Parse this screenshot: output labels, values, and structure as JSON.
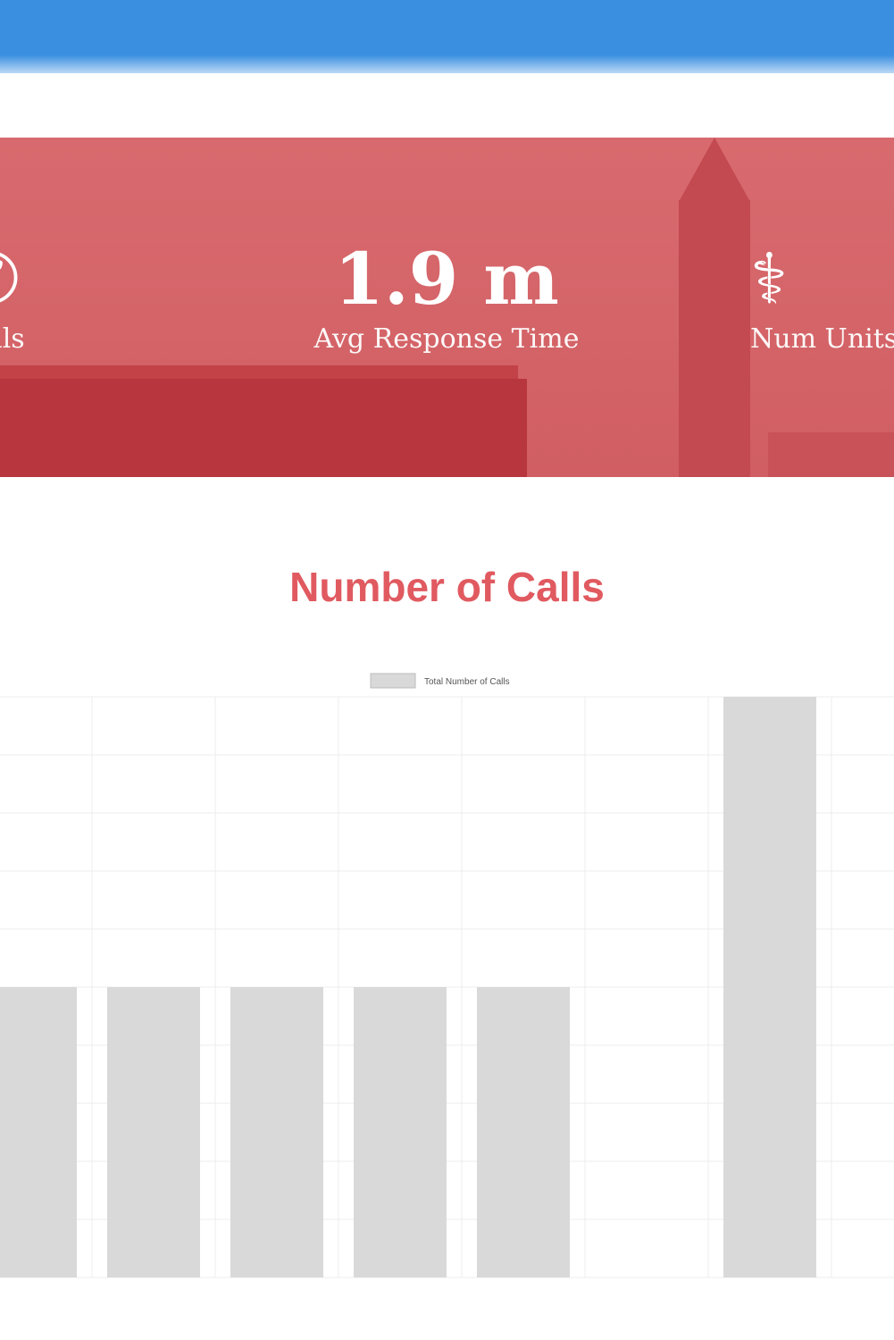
{
  "header": {
    "brand_color": "#3a8fe0"
  },
  "hero": {
    "background_color": "#d46468",
    "stats": [
      {
        "value": "",
        "label": "Calls",
        "icon": "phone-icon"
      },
      {
        "value": "1.9 m",
        "label": "Avg Response Time",
        "icon": ""
      },
      {
        "value": "",
        "label": "Num Units",
        "icon": "ambulance-icon"
      }
    ]
  },
  "chart": {
    "title": "Number of Calls"
  },
  "chart_data": {
    "type": "bar",
    "title": "Number of Calls",
    "legend": [
      "Total Number of Calls"
    ],
    "legend_position": "top-center",
    "grid": true,
    "categories": [
      "",
      "",
      "",
      "",
      "",
      "",
      "",
      ""
    ],
    "series": [
      {
        "name": "Total Number of Calls",
        "values": [
          1,
          1,
          1,
          1,
          1,
          0,
          2,
          0
        ]
      }
    ],
    "ylim": [
      0,
      2
    ],
    "colors": {
      "bar": "#d9d9d9",
      "title": "#e05a60"
    }
  }
}
